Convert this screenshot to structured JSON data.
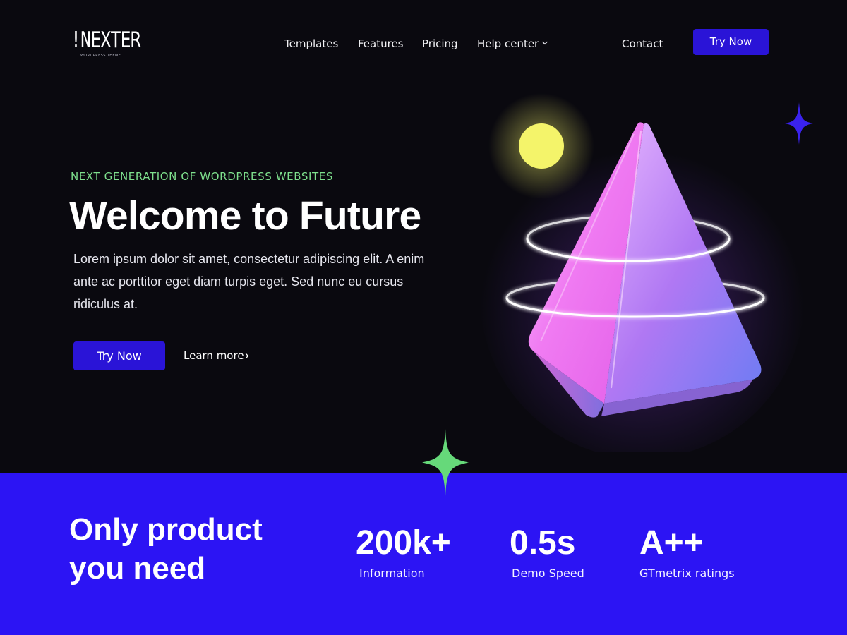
{
  "brand": {
    "logo_text": "!NEXTER",
    "logo_subtitle": "WORDPRESS THEME"
  },
  "nav": {
    "items": [
      {
        "label": "Templates"
      },
      {
        "label": "Features"
      },
      {
        "label": "Pricing"
      },
      {
        "label": "Help center"
      }
    ],
    "contact_label": "Contact",
    "cta_label": "Try Now"
  },
  "hero": {
    "eyebrow": "NEXT GENERATION OF WORDPRESS WEBSITES",
    "title": "Welcome to Future",
    "body": "Lorem ipsum dolor sit amet, consectetur adipiscing elit. A enim ante ac porttitor eget diam turpis eget. Sed nunc eu cursus ridiculus at.",
    "cta_label": "Try Now",
    "secondary_label": "Learn more"
  },
  "stats": {
    "title_line1": "Only product",
    "title_line2": "you need",
    "items": [
      {
        "value": "200k+",
        "label": "Information"
      },
      {
        "value": "0.5s",
        "label": "Demo Speed"
      },
      {
        "value": "A++",
        "label": "GTmetrix ratings"
      }
    ]
  },
  "icons": {
    "chevron": "chevron-down-icon",
    "arrow": "chevron-right-icon",
    "sparkle": "sparkle-icon",
    "illustration": "glass-pyramid-illustration"
  },
  "colors": {
    "background": "#0a090f",
    "accent": "#2a14d7",
    "band": "#2c14f4",
    "eyebrow": "#7ee08d",
    "sun": "#f4f46a",
    "sparkle_blue": "#3a22ee",
    "sparkle_green": "#66d97a"
  }
}
